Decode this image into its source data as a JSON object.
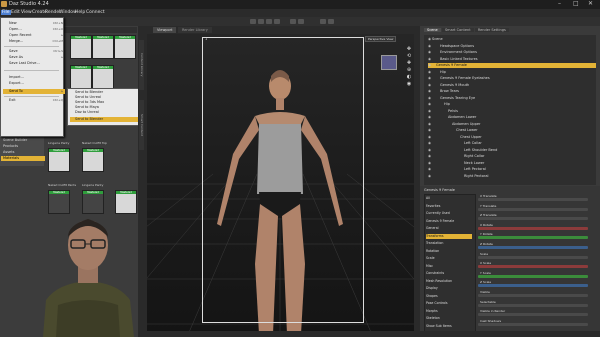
{
  "window": {
    "title": "Daz Studio 4.24",
    "controls": [
      "–",
      "□",
      "✕"
    ]
  },
  "menubar": [
    "File",
    "Edit",
    "View",
    "Create",
    "Render",
    "Window",
    "Help",
    "Connect"
  ],
  "file_menu": {
    "items": [
      {
        "label": "New",
        "shortcut": "Ctrl+N"
      },
      {
        "label": "Open...",
        "shortcut": "Ctrl+O"
      },
      {
        "label": "Open Recent",
        "shortcut": "▸"
      },
      {
        "label": "Merge...",
        "shortcut": "Ctrl+M"
      },
      {
        "label": "Save",
        "shortcut": "Ctrl+S"
      },
      {
        "label": "Save As",
        "shortcut": "▸"
      },
      {
        "label": "Save Last Drive...",
        "shortcut": ""
      },
      {
        "label": "Import...",
        "shortcut": ""
      },
      {
        "label": "Export...",
        "shortcut": ""
      },
      {
        "label": "Send To",
        "shortcut": "▸"
      },
      {
        "label": "Exit",
        "shortcut": "Ctrl+Q"
      }
    ],
    "selected": "Send To"
  },
  "send_to_submenu": {
    "items": [
      "Send to Blender",
      "Send to Unreal",
      "Send to 3ds Max",
      "Send to Maya",
      "Daz to Unreal",
      "Send to Blender"
    ],
    "selected_index": 5
  },
  "library_sidebar": {
    "items": [
      "Saved Files",
      "Scene Builder",
      "Products",
      "Assets",
      "Materials"
    ],
    "selected_index": 4
  },
  "library_tiles": [
    {
      "label": "Lingerie Panty",
      "badge": "Mastered"
    },
    {
      "label": "Lingerie Panty",
      "badge": "Mastered"
    },
    {
      "label": "Lingerie Panty",
      "badge": "Mastered"
    },
    {
      "label": "Lingerie Panty",
      "badge": "Mastered"
    },
    {
      "label": "Lingerie Panty",
      "badge": "Mastered"
    },
    {
      "label": "Lingerie Panty",
      "badge": "Mastered"
    },
    {
      "label": "Lingerie Panty",
      "badge": "Mastered"
    },
    {
      "label": "Lingerie Panty",
      "badge": "Mastered"
    },
    {
      "label": "Lingerie Panty",
      "badge": "Mastered"
    },
    {
      "label": "Lingerie Panty",
      "badge": "Mastered"
    },
    {
      "label": "Lingerie Panty",
      "badge": "Mastered"
    },
    {
      "label": "Lingerie Panty",
      "badge": "Mastered"
    }
  ],
  "library_labels": [
    "Lingerie Panty",
    "Naked Outfit Top",
    "Naked Outfit Pants",
    "Lingerie Panty"
  ],
  "viewport": {
    "tabs": [
      "Viewport",
      "Render Library"
    ],
    "camera_label": "Perspective View",
    "aux_label": "1",
    "tool_icons": [
      "✥",
      "⟲",
      "✚",
      "⊕",
      "◐",
      "◉"
    ]
  },
  "right_panel": {
    "tabs": [
      "Scene",
      "Smart Content",
      "Render Settings"
    ],
    "tree": [
      {
        "label": "Scene",
        "indent": 0,
        "sel": false
      },
      {
        "label": "Headspace Options",
        "indent": 2,
        "sel": false
      },
      {
        "label": "Environment Options",
        "indent": 2,
        "sel": false
      },
      {
        "label": "Basic Linked Textures",
        "indent": 2,
        "sel": false
      },
      {
        "label": "Genesis 9 Female",
        "indent": 1,
        "sel": true
      },
      {
        "label": "Hip",
        "indent": 2,
        "sel": false
      },
      {
        "label": "Genesis 9 Female Eyelashes",
        "indent": 2,
        "sel": false
      },
      {
        "label": "Genesis 9 Mouth",
        "indent": 2,
        "sel": false
      },
      {
        "label": "Brow Tears",
        "indent": 2,
        "sel": false
      },
      {
        "label": "Genesis Tearing Eye",
        "indent": 2,
        "sel": false
      },
      {
        "label": "Hip",
        "indent": 3,
        "sel": false
      },
      {
        "label": "Pelvis",
        "indent": 4,
        "sel": false
      },
      {
        "label": "Abdomen Lower",
        "indent": 4,
        "sel": false
      },
      {
        "label": "Abdomen Upper",
        "indent": 5,
        "sel": false
      },
      {
        "label": "Chest Lower",
        "indent": 6,
        "sel": false
      },
      {
        "label": "Chest Upper",
        "indent": 7,
        "sel": false
      },
      {
        "label": "Left Collar",
        "indent": 8,
        "sel": false
      },
      {
        "label": "Left Shoulder Bend",
        "indent": 8,
        "sel": false
      },
      {
        "label": "Right Collar",
        "indent": 8,
        "sel": false
      },
      {
        "label": "Neck Lower",
        "indent": 8,
        "sel": false
      },
      {
        "label": "Left Pectoral",
        "indent": 8,
        "sel": false
      },
      {
        "label": "Right Pectoral",
        "indent": 8,
        "sel": false
      }
    ]
  },
  "parameters": {
    "header": "Genesis 9 Female",
    "left_list": [
      "All",
      "Favorites",
      "Currently Used",
      "Genesis 9 Female",
      "General",
      "Transforms",
      "Translation",
      "Rotation",
      "Scale",
      "Misc",
      "Constraints",
      "Mesh Resolution",
      "Display",
      "Shapes",
      "Pose Controls",
      "Morphs",
      "Skeleton",
      "Show Sub Items"
    ],
    "selected_left": "Transforms",
    "rows": [
      {
        "name": "X Translate",
        "color": "#4a4a4a"
      },
      {
        "name": "Y Translate",
        "color": "#4a4a4a"
      },
      {
        "name": "Z Translate",
        "color": "#4a4a4a"
      },
      {
        "name": "X Rotate",
        "color": "#8c3b3b"
      },
      {
        "name": "Y Rotate",
        "color": "#3b8c3b"
      },
      {
        "name": "Z Rotate",
        "color": "#3b5f8c"
      },
      {
        "name": "Scale",
        "color": "#4a4a4a"
      },
      {
        "name": "X Scale",
        "color": "#8c3b3b"
      },
      {
        "name": "Y Scale",
        "color": "#3b8c3b"
      },
      {
        "name": "Z Scale",
        "color": "#3b5f8c"
      },
      {
        "name": "Visible",
        "color": "#4a4a4a"
      },
      {
        "name": "Selectable",
        "color": "#4a4a4a"
      },
      {
        "name": "Visible in Render",
        "color": "#4a4a4a"
      },
      {
        "name": "Cast Shadows",
        "color": "#4a4a4a"
      }
    ]
  },
  "colors": {
    "accent": "#e3b336",
    "highlight": "#4d7fd1",
    "badge": "#2f9e3c"
  }
}
